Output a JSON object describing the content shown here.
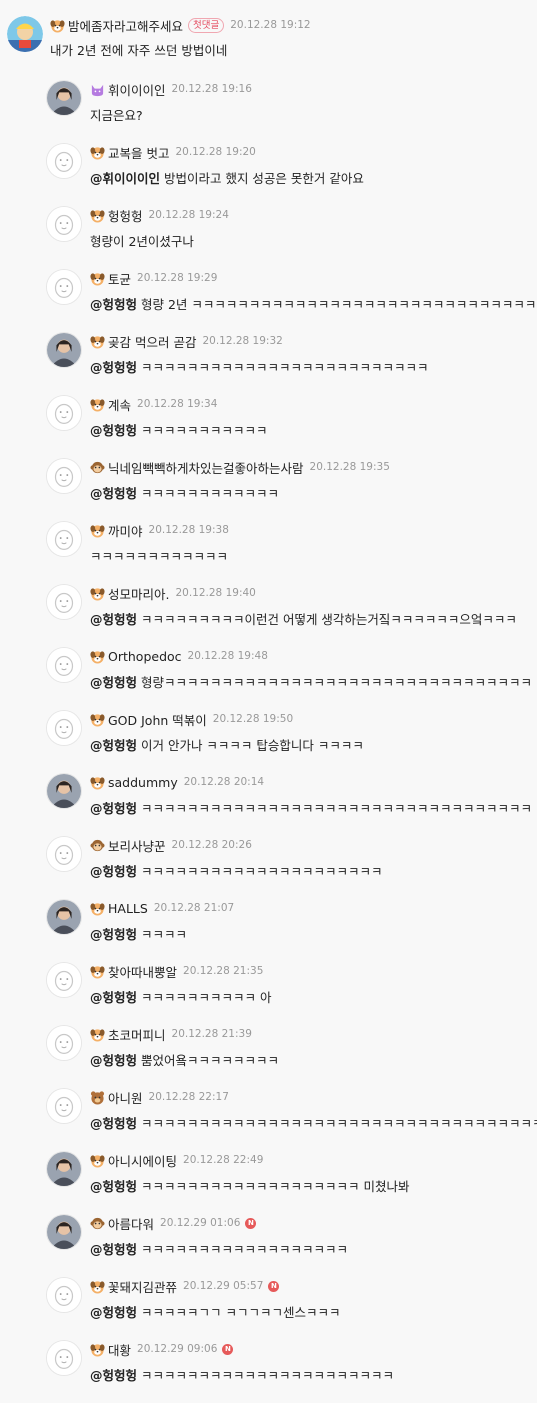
{
  "main_comment": {
    "nickname": "밤에좀자라고해주세요",
    "first_badge": "첫댓글",
    "timestamp": "20.12.28 19:12",
    "text": "내가 2년 전에 자주 쓰던 방법이네",
    "level_icon": "dog-level-icon"
  },
  "replies": [
    {
      "nickname": "휘이이이인",
      "timestamp": "20.12.28 19:16",
      "mention": "",
      "text": "지금은요?",
      "level_icon": "cat-level-icon",
      "avatar": "photo-avatar"
    },
    {
      "nickname": "교복을 벗고",
      "timestamp": "20.12.28 19:20",
      "mention": "@휘이이이인",
      "text": " 방법이라고 했지 성공은 못한거 같아요",
      "level_icon": "dog-level-icon",
      "avatar": "default-avatar"
    },
    {
      "nickname": "헝헝헝",
      "timestamp": "20.12.28 19:24",
      "mention": "",
      "text": "형량이 2년이셨구나",
      "level_icon": "dog-level-icon",
      "avatar": "default-avatar"
    },
    {
      "nickname": "토균",
      "timestamp": "20.12.28 19:29",
      "mention": "@헝헝헝",
      "text": " 형량 2년 ㅋㅋㅋㅋㅋㅋㅋㅋㅋㅋㅋㅋㅋㅋㅋㅋㅋㅋㅋㅋㅋㅋㅋㅋㅋㅋㅋㅋㅋㅋ",
      "level_icon": "dog-level-icon",
      "avatar": "default-avatar"
    },
    {
      "nickname": "곶감 먹으러 곧감",
      "timestamp": "20.12.28 19:32",
      "mention": "@헝헝헝",
      "text": " ㅋㅋㅋㅋㅋㅋㅋㅋㅋㅋㅋㅋㅋㅋㅋㅋㅋㅋㅋㅋㅋㅋㅋㅋㅋ",
      "level_icon": "dog-level-icon",
      "avatar": "photo-avatar"
    },
    {
      "nickname": "계속",
      "timestamp": "20.12.28 19:34",
      "mention": "@헝헝헝",
      "text": " ㅋㅋㅋㅋㅋㅋㅋㅋㅋㅋㅋ",
      "level_icon": "dog-level-icon",
      "avatar": "default-avatar"
    },
    {
      "nickname": "닉네임빽빽하게차있는걸좋아하는사람",
      "timestamp": "20.12.28 19:35",
      "mention": "@헝헝헝",
      "text": " ㅋㅋㅋㅋㅋㅋㅋㅋㅋㅋㅋㅋ",
      "level_icon": "monkey-level-icon",
      "avatar": "default-avatar"
    },
    {
      "nickname": "까미야",
      "timestamp": "20.12.28 19:38",
      "mention": "",
      "text": "ㅋㅋㅋㅋㅋㅋㅋㅋㅋㅋㅋㅋ",
      "level_icon": "dog-level-icon",
      "avatar": "default-avatar"
    },
    {
      "nickname": "성모마리아.",
      "timestamp": "20.12.28 19:40",
      "mention": "@헝헝헝",
      "text": " ㅋㅋㅋㅋㅋㅋㅋㅋㅋ이런건 어떻게 생각하는거짘ㅋㅋㅋㅋㅋㅋ으엌ㅋㅋㅋ",
      "level_icon": "dog-level-icon",
      "avatar": "default-avatar"
    },
    {
      "nickname": "Orthopedoc",
      "timestamp": "20.12.28 19:48",
      "mention": "@헝헝헝",
      "text": " 형량ㅋㅋㅋㅋㅋㅋㅋㅋㅋㅋㅋㅋㅋㅋㅋㅋㅋㅋㅋㅋㅋㅋㅋㅋㅋㅋㅋㅋㅋㅋㅋㅋ",
      "level_icon": "dog-level-icon",
      "avatar": "default-avatar"
    },
    {
      "nickname": "GOD John 떡볶이",
      "timestamp": "20.12.28 19:50",
      "mention": "@헝헝헝",
      "text": " 이거 안가나 ㅋㅋㅋㅋ 탑승합니다 ㅋㅋㅋㅋ",
      "level_icon": "dog-level-icon",
      "avatar": "default-avatar"
    },
    {
      "nickname": "saddummy",
      "timestamp": "20.12.28 20:14",
      "mention": "@헝헝헝",
      "text": " ㅋㅋㅋㅋㅋㅋㅋㅋㅋㅋㅋㅋㅋㅋㅋㅋㅋㅋㅋㅋㅋㅋㅋㅋㅋㅋㅋㅋㅋㅋㅋㅋㅋㅋ",
      "level_icon": "dog-level-icon",
      "avatar": "photo-avatar"
    },
    {
      "nickname": "보리사냥꾼",
      "timestamp": "20.12.28 20:26",
      "mention": "@헝헝헝",
      "text": " ㅋㅋㅋㅋㅋㅋㅋㅋㅋㅋㅋㅋㅋㅋㅋㅋㅋㅋㅋㅋㅋ",
      "level_icon": "monkey-level-icon",
      "avatar": "default-avatar"
    },
    {
      "nickname": "HALLS",
      "timestamp": "20.12.28 21:07",
      "mention": "@헝헝헝",
      "text": " ㅋㅋㅋㅋ",
      "level_icon": "dog-level-icon",
      "avatar": "photo-avatar"
    },
    {
      "nickname": "찾아따내뿡알",
      "timestamp": "20.12.28 21:35",
      "mention": "@헝헝헝",
      "text": " ㅋㅋㅋㅋㅋㅋㅋㅋㅋㅋ 아",
      "level_icon": "dog-level-icon",
      "avatar": "default-avatar"
    },
    {
      "nickname": "초코머피니",
      "timestamp": "20.12.28 21:39",
      "mention": "@헝헝헝",
      "text": " 뿜었어욬ㅋㅋㅋㅋㅋㅋㅋㅋ",
      "level_icon": "dog-level-icon",
      "avatar": "default-avatar"
    },
    {
      "nickname": "아니원",
      "timestamp": "20.12.28 22:17",
      "mention": "@헝헝헝",
      "text": " ㅋㅋㅋㅋㅋㅋㅋㅋㅋㅋㅋㅋㅋㅋㅋㅋㅋㅋㅋㅋㅋㅋㅋㅋㅋㅋㅋㅋㅋㅋㅋㅋㅋㅋㅋ",
      "level_icon": "bear-level-icon",
      "avatar": "default-avatar"
    },
    {
      "nickname": "아니시에이팅",
      "timestamp": "20.12.28 22:49",
      "mention": "@헝헝헝",
      "text": " ㅋㅋㅋㅋㅋㅋㅋㅋㅋㅋㅋㅋㅋㅋㅋㅋㅋㅋㅋ 미쳤나봐",
      "level_icon": "dog-level-icon",
      "avatar": "photo-avatar"
    },
    {
      "nickname": "아름다워",
      "timestamp": "20.12.29 01:06",
      "mention": "@헝헝헝",
      "text": " ㅋㅋㅋㅋㅋㅋㅋㅋㅋㅋㅋㅋㅋㅋㅋㅋㅋㅋ",
      "level_icon": "monkey-level-icon",
      "avatar": "photo-avatar",
      "new_badge": "N"
    },
    {
      "nickname": "꽃돼지김관쮸",
      "timestamp": "20.12.29 05:57",
      "mention": "@헝헝헝",
      "text": " ㅋㅋㅋㅋㅋㄱㄱ ㅋㄱㄱㅋㄱ센스ㅋㅋㅋ",
      "level_icon": "dog-level-icon",
      "avatar": "default-avatar",
      "new_badge": "N"
    },
    {
      "nickname": "대황",
      "timestamp": "20.12.29 09:06",
      "mention": "@헝헝헝",
      "text": " ㅋㅋㅋㅋㅋㅋㅋㅋㅋㅋㅋㅋㅋㅋㅋㅋㅋㅋㅋㅋㅋㅋ",
      "level_icon": "dog-level-icon",
      "avatar": "default-avatar",
      "new_badge": "N"
    }
  ],
  "colors": {
    "background": "#f8f8f8",
    "text": "#222222",
    "timestamp": "#999999",
    "first_badge": "#e4495e",
    "new_badge": "#e65a5a"
  }
}
